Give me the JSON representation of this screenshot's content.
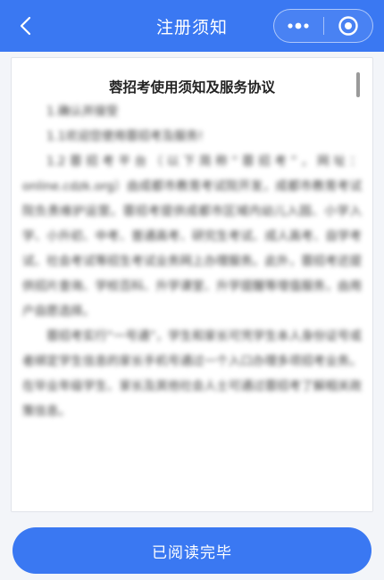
{
  "nav": {
    "title": "注册须知",
    "back_icon": "chevron-left-icon",
    "more_icon": "more-dots-icon",
    "close_icon": "target-circle-icon",
    "background": "#3a78f2"
  },
  "document": {
    "title": "蓉招考使用须知及服务协议",
    "paragraphs": [
      "1.确认并接受",
      "1.1欢迎您使用蓉招考及服务!",
      "1.2蓉招考平台（以下简称“蓉招考”，网址：online.cdzk.org）由成都市教育考试院开发，成都市教育考试院负责维护运营。蓉招考提供成都市区域内幼儿入园、小学入学、小升初、中考、普通高考、研究生考试、成人高考、自学考试、社会考试等招生考试业务网上办理服务。此外，蓉招考还提供招片查询、学校百科、升学课堂、升学提醒等增值服务，由用户自愿选择。",
      "蓉招考实行“一号通”，学生和家长可凭学生本人身份证号或者绑定学生信息的家长手机号通过一个入口办理多项招考业务。在毕业年级学生、家长及其他社会人士可通过蓉招考了解相关政策信息。"
    ]
  },
  "footer": {
    "done_label": "已阅读完毕",
    "accent": "#3a78f2"
  }
}
